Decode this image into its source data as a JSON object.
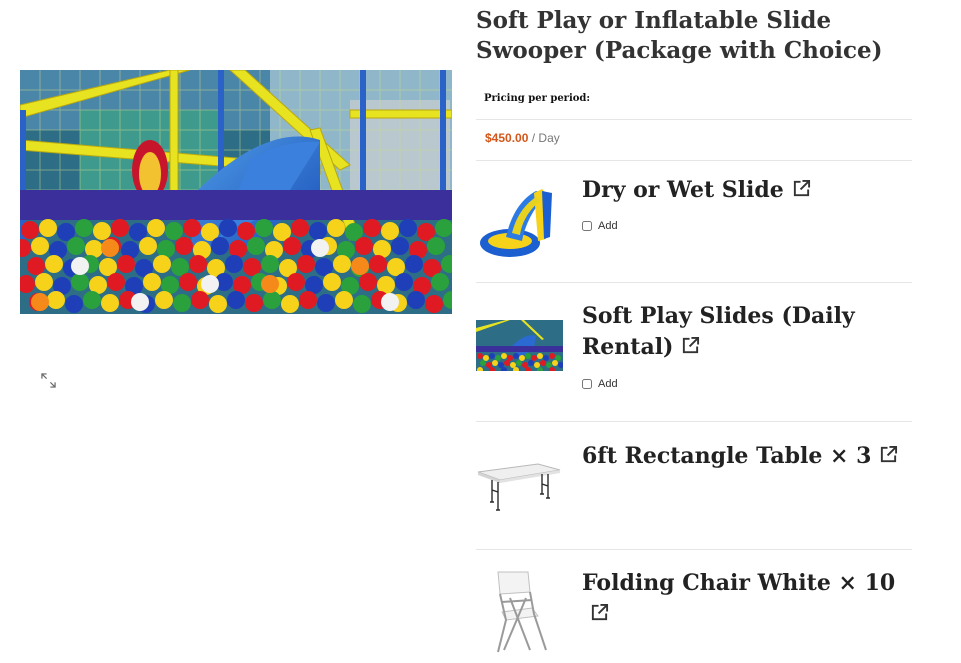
{
  "product": {
    "title": "Soft Play or Inflatable Slide Swooper (Package with Choice)",
    "pricing_label": "Pricing per period:",
    "price": "$450.00",
    "price_period": "/ Day",
    "accent_color": "#d4561a"
  },
  "gallery": {
    "main_image_alt": "Soft play area with blue slide and ball pit",
    "zoom_icon": "expand-icon"
  },
  "addons": [
    {
      "name": "Dry or Wet Slide",
      "add_label": "Add",
      "checked": false,
      "thumb": "water-slide-image"
    },
    {
      "name": "Soft Play Slides (Daily Rental)",
      "add_label": "Add",
      "checked": false,
      "thumb": "soft-play-image"
    },
    {
      "name": "6ft Rectangle Table × 3",
      "thumb": "folding-table-image"
    },
    {
      "name": "Folding Chair White × 10",
      "thumb": "folding-chair-image"
    }
  ]
}
